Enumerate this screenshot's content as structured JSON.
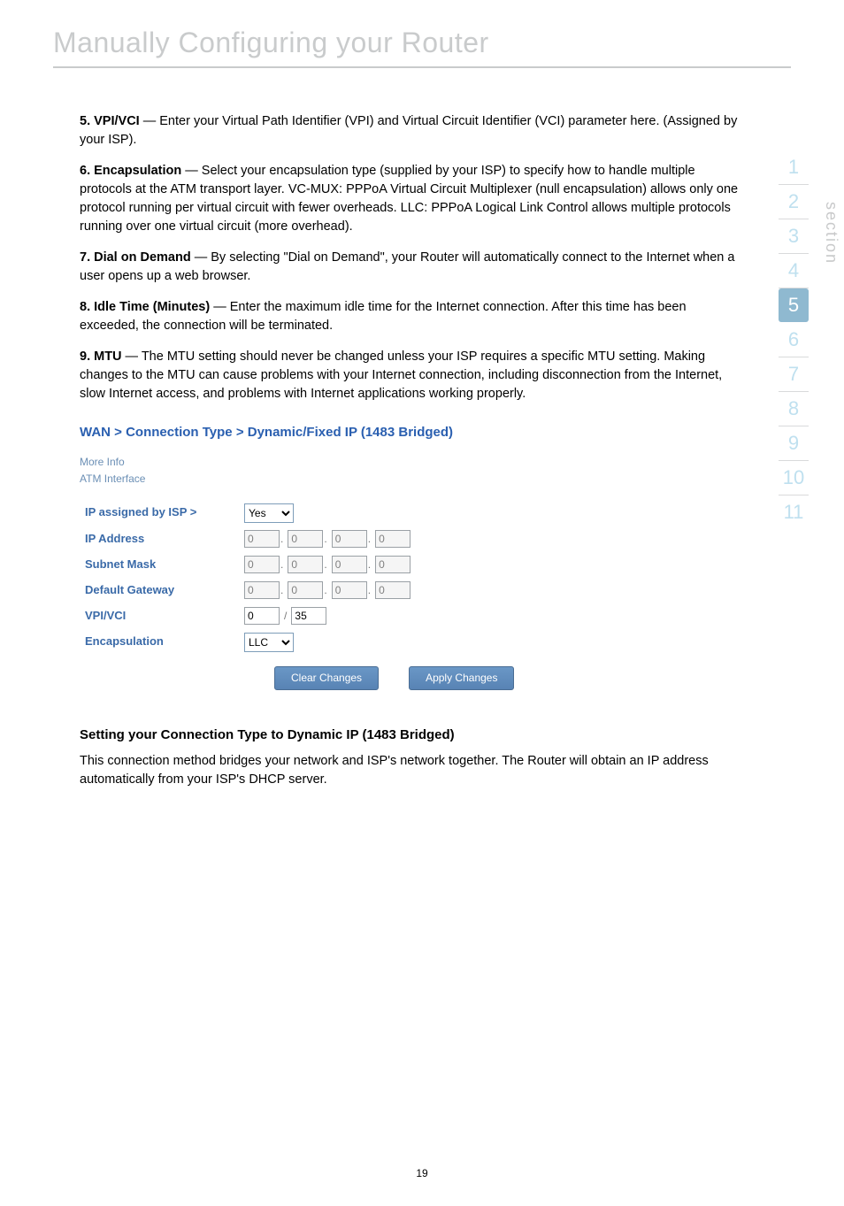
{
  "title": "Manually Configuring your Router",
  "items": [
    {
      "label": "5. VPI/VCI",
      "text": " — Enter your Virtual Path Identifier (VPI) and Virtual Circuit Identifier (VCI) parameter here. (Assigned by your ISP)."
    },
    {
      "label": "6. Encapsulation",
      "text": " — Select your encapsulation type (supplied by your ISP) to specify how to handle multiple protocols at the ATM transport layer. VC-MUX: PPPoA Virtual Circuit Multiplexer (null encapsulation) allows only one protocol running per virtual circuit with fewer overheads. LLC: PPPoA Logical Link Control allows multiple protocols running over one virtual circuit (more overhead)."
    },
    {
      "label": "7. Dial on Demand",
      "text": " — By selecting \"Dial on Demand\", your Router will automatically connect to the Internet when a user opens up a web browser."
    },
    {
      "label": "8. Idle Time (Minutes)",
      "text": " — Enter the maximum idle time for the Internet connection. After this time has been exceeded, the connection will be terminated."
    },
    {
      "label": "9. MTU",
      "text": " — The MTU setting should never be changed unless your ISP requires a specific MTU setting. Making changes to the MTU can cause problems with your Internet connection, including disconnection from the Internet, slow Internet access, and problems with Internet applications working properly."
    }
  ],
  "wan": {
    "breadcrumb": "WAN > Connection Type > Dynamic/Fixed IP (1483 Bridged)",
    "more_info": "More Info",
    "atm": "ATM Interface",
    "rows": {
      "ip_assigned": "IP assigned by ISP >",
      "ip_address": "IP Address",
      "subnet": "Subnet Mask",
      "gateway": "Default Gateway",
      "vpivci": "VPI/VCI",
      "encap": "Encapsulation"
    },
    "ip_assigned_value": "Yes",
    "ip": [
      "0",
      "0",
      "0",
      "0"
    ],
    "sm": [
      "0",
      "0",
      "0",
      "0"
    ],
    "gw": [
      "0",
      "0",
      "0",
      "0"
    ],
    "vpi": "0",
    "vci": "35",
    "encap_value": "LLC",
    "btn_clear": "Clear Changes",
    "btn_apply": "Apply Changes"
  },
  "setting_heading": "Setting your Connection Type to Dynamic IP (1483 Bridged)",
  "setting_text": "This connection method bridges your network and ISP's network together. The Router will obtain an IP address automatically from your ISP's DHCP server.",
  "sidebar": {
    "label": "section",
    "numbers": [
      "1",
      "2",
      "3",
      "4",
      "5",
      "6",
      "7",
      "8",
      "9",
      "10",
      "11"
    ],
    "active": "5"
  },
  "page_number": "19"
}
